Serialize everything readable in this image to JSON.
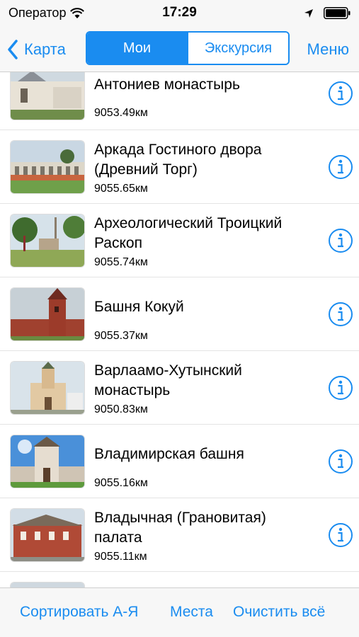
{
  "status_bar": {
    "carrier": "Оператор",
    "time": "17:29"
  },
  "nav": {
    "back_label": "Карта",
    "segments": [
      "Мои",
      "Экскурсия"
    ],
    "selected_segment": "Мои",
    "menu_label": "Меню"
  },
  "list": {
    "items": [
      {
        "title": "Антониев монастырь",
        "distance": "9053.49км"
      },
      {
        "title": "Аркада Гостиного двора (Древний Торг)",
        "distance": "9055.65км"
      },
      {
        "title": "Археологический Троицкий Раскоп",
        "distance": "9055.74км"
      },
      {
        "title": "Башня Кокуй",
        "distance": "9055.37км"
      },
      {
        "title": "Варлаамо-Хутынский монастырь",
        "distance": "9050.83км"
      },
      {
        "title": "Владимирская башня",
        "distance": "9055.16км"
      },
      {
        "title": "Владычная (Грановитая) палата",
        "distance": "9055.11км"
      }
    ]
  },
  "toolbar": {
    "sort_label": "Сортировать А-Я",
    "places_label": "Места",
    "clear_label": "Очистить всё"
  },
  "colors": {
    "accent": "#1a8cf0",
    "bar_background": "#f7f7f7"
  },
  "icons": [
    "wifi-icon",
    "location-arrow-icon",
    "battery-icon",
    "chevron-left-icon",
    "info-icon"
  ]
}
